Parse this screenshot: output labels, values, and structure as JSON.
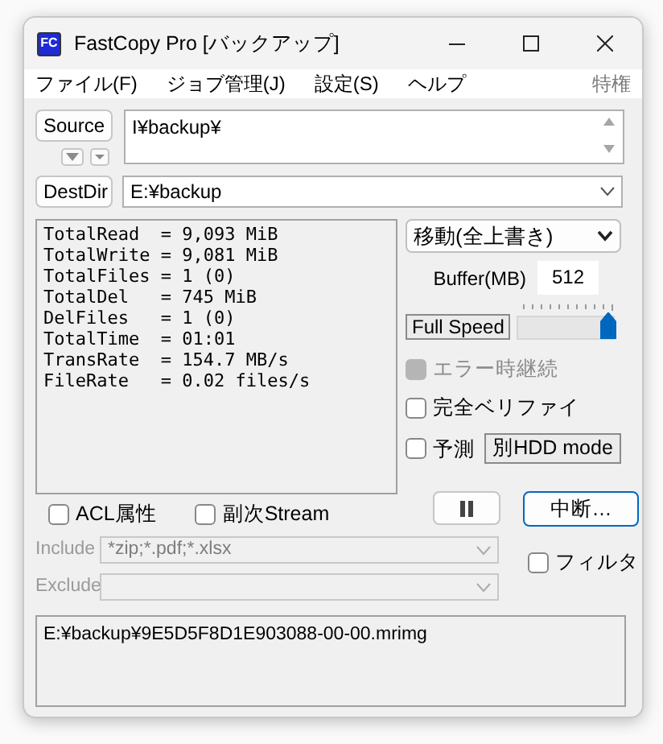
{
  "window": {
    "icon_text": "FC",
    "title": "FastCopy Pro [バックアップ]"
  },
  "menu": [
    {
      "label": "ファイル(F)"
    },
    {
      "label": "ジョブ管理(J)"
    },
    {
      "label": "設定(S)"
    },
    {
      "label": "ヘルプ"
    }
  ],
  "privilege": {
    "label": "特権",
    "disabled": true
  },
  "source": {
    "button": "Source",
    "path": "I¥backup¥"
  },
  "dest": {
    "button": "DestDir",
    "path": "E:¥backup"
  },
  "stats": [
    "TotalRead  = 9,093 MiB",
    "TotalWrite = 9,081 MiB",
    "TotalFiles = 1 (0)",
    "TotalDel   = 745 MiB",
    "DelFiles   = 1 (0)",
    "TotalTime  = 01:01",
    "TransRate  = 154.7 MB/s",
    "FileRate   = 0.02 files/s"
  ],
  "mode": "移動(全上書き)",
  "buffer": {
    "label": "Buffer(MB)",
    "value": "512"
  },
  "speed": {
    "label": "Full Speed",
    "level": 1
  },
  "options": [
    {
      "label": "エラー時継続",
      "checked": true,
      "disabled": true
    },
    {
      "label": "完全ベリファイ",
      "checked": false,
      "disabled": false
    },
    {
      "label": "予測",
      "checked": false,
      "disabled": false
    }
  ],
  "hdd_mode": "別HDD mode",
  "abort_button": "中断…",
  "attributes": [
    {
      "label": "ACL属性",
      "checked": false
    },
    {
      "label": "副次Stream",
      "checked": false
    }
  ],
  "include": {
    "label": "Include",
    "value": "*zip;*.pdf;*.xlsx",
    "disabled": true
  },
  "exclude": {
    "label": "Exclude",
    "disabled": true
  },
  "filter": {
    "label": "フィルタ",
    "checked": false
  },
  "log": "E:¥backup¥9E5D5F8D1E903088-00-00.mrimg"
}
